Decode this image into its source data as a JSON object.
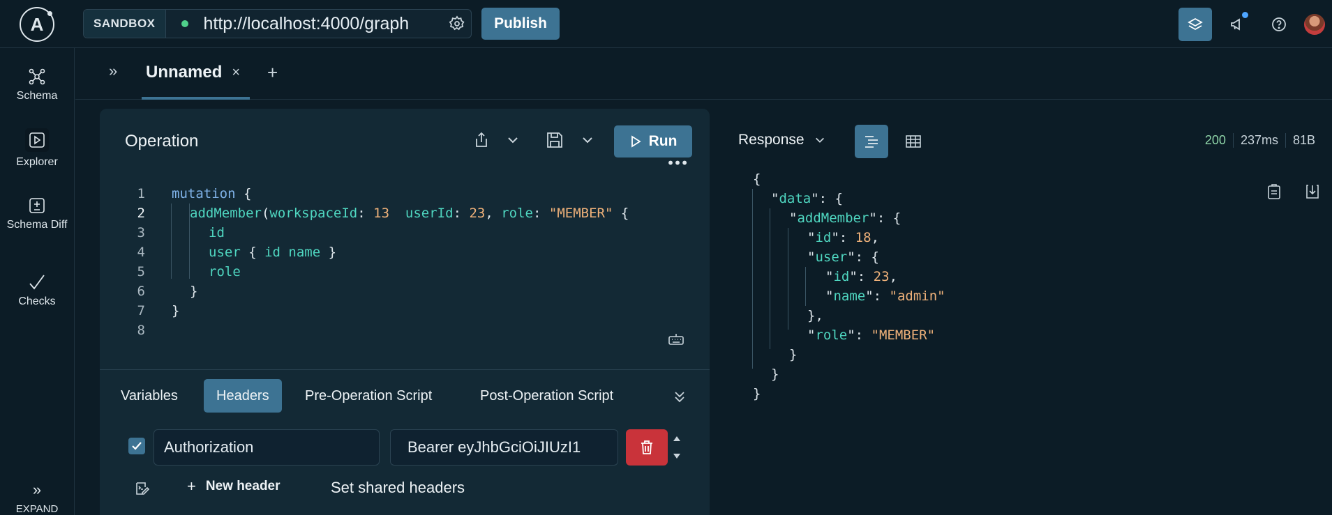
{
  "topbar": {
    "sandbox_label": "SANDBOX",
    "url": "http://localhost:4000/graph",
    "publish_label": "Publish"
  },
  "sidebar": {
    "items": [
      {
        "label": "Schema",
        "icon": "schema-icon"
      },
      {
        "label": "Explorer",
        "icon": "explorer-icon"
      },
      {
        "label": "Schema Diff",
        "icon": "schema-diff-icon"
      },
      {
        "label": "Checks",
        "icon": "checks-icon"
      }
    ],
    "expand_label": "EXPAND"
  },
  "tabs": {
    "active_tab_label": "Unnamed",
    "close_glyph": "×",
    "add_glyph": "+"
  },
  "operation": {
    "title": "Operation",
    "run_label": "Run",
    "line_numbers": [
      "1",
      "2",
      "3",
      "4",
      "5",
      "6",
      "7",
      "8"
    ],
    "code": {
      "l1_kw": "mutation",
      "l1_rest": " {",
      "l2_fn": "addMember",
      "l2_a1": "workspaceId",
      "l2_v1": "13",
      "l2_a2": "userId",
      "l2_v2": "23",
      "l2_a3": "role",
      "l2_v3": "\"MEMBER\"",
      "l3": "id",
      "l4_a": "user",
      "l4_b": "id name",
      "l5": "role"
    }
  },
  "bottom_tabs": {
    "variables": "Variables",
    "headers": "Headers",
    "pre_script": "Pre-Operation Script",
    "post_script": "Post-Operation Script"
  },
  "headers": {
    "row_key": "Authorization",
    "row_value": "Bearer eyJhbGciOiJIUzI1",
    "new_header_label": "New header",
    "shared_headers_label": "Set shared headers"
  },
  "response": {
    "title": "Response",
    "status": "200",
    "time": "237ms",
    "size": "81B",
    "json": {
      "data_key": "data",
      "addMember_key": "addMember",
      "id_key": "id",
      "id_val": "18",
      "user_key": "user",
      "user_id_key": "id",
      "user_id_val": "23",
      "name_key": "name",
      "name_val": "\"admin\"",
      "role_key": "role",
      "role_val": "\"MEMBER\""
    }
  }
}
